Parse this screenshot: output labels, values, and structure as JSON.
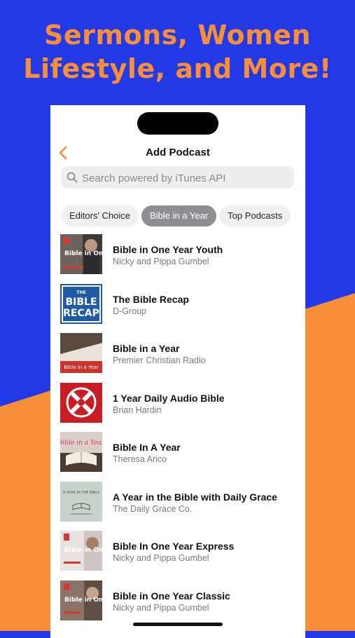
{
  "headline": {
    "line1": "Sermons, Women",
    "line2": "Lifestyle, and More!"
  },
  "colors": {
    "background_blue": "#2339e6",
    "accent_orange": "#f78e3a",
    "phone_white": "#ffffff"
  },
  "nav": {
    "title": "Add Podcast",
    "back_icon": "chevron-left-icon"
  },
  "search": {
    "placeholder": "Search powered by iTunes API",
    "value": ""
  },
  "tabs": [
    {
      "label": "Editors' Choice",
      "active": false
    },
    {
      "label": "Bible in a Year",
      "active": true
    },
    {
      "label": "Top Podcasts",
      "active": false
    }
  ],
  "podcasts": [
    {
      "title": "Bible in One Year Youth",
      "author": "Nicky and Pippa Gumbel",
      "art_text": "Bible in One Year"
    },
    {
      "title": "The Bible Recap",
      "author": "D-Group",
      "art_text": "THE BIBLE RECAP"
    },
    {
      "title": "Bible in a Year",
      "author": "Premier Christian Radio",
      "art_text": "Bible in a Year"
    },
    {
      "title": "1 Year Daily Audio Bible",
      "author": "Brian Hardin",
      "art_text": ""
    },
    {
      "title": "Bible In A Year",
      "author": "Theresa Arico",
      "art_text": "Bible in a Year"
    },
    {
      "title": "A Year in the Bible with Daily Grace",
      "author": "The Daily Grace Co.",
      "art_text": "A YEAR IN THE BIBLE"
    },
    {
      "title": "Bible In One Year Express",
      "author": "Nicky and Pippa Gumbel",
      "art_text": "Bible in One Year"
    },
    {
      "title": "Bible in One Year Classic",
      "author": "Nicky and Pippa Gumbel",
      "art_text": "Bible in One Year"
    }
  ]
}
